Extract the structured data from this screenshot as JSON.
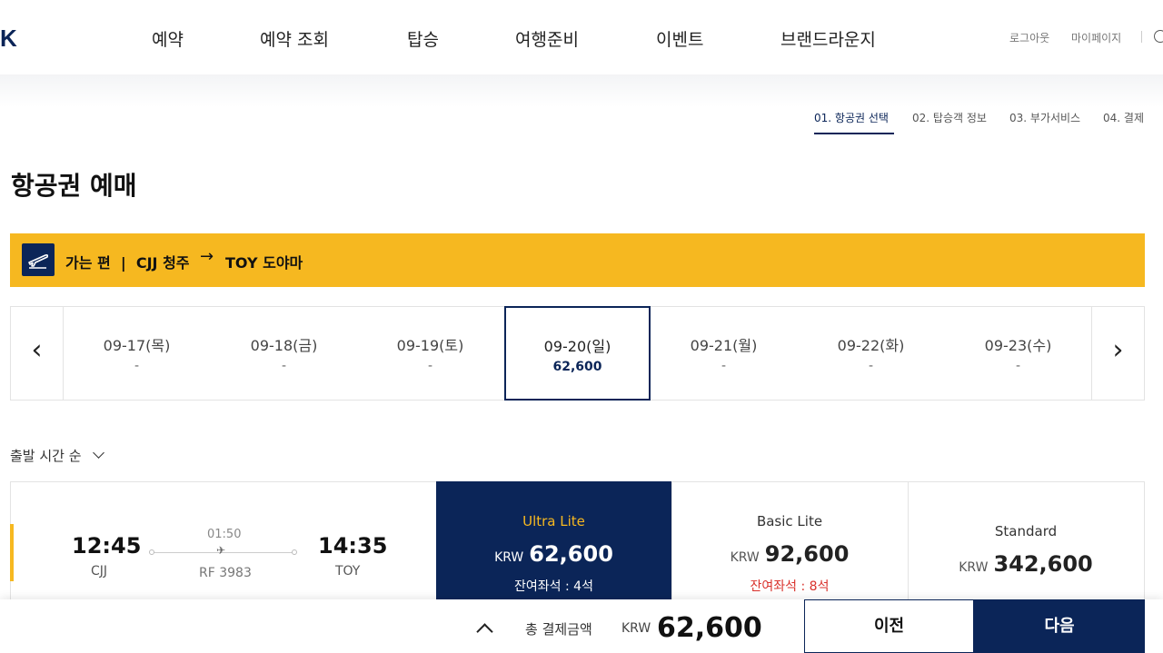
{
  "header": {
    "logo": "K",
    "nav": [
      "예약",
      "예약 조회",
      "탑승",
      "여행준비",
      "이벤트",
      "브랜드라운지"
    ],
    "utility": [
      "로그아웃",
      "마이페이지"
    ]
  },
  "steps": [
    "01. 항공권 선택",
    "02. 탑승객 정보",
    "03. 부가서비스",
    "04. 결제"
  ],
  "page_title": "항공권 예매",
  "route": {
    "label": "가는 편  |  CJJ 청주",
    "arrow": "→",
    "destination": "TOY 도야마"
  },
  "dates": [
    {
      "date": "09-17(목)",
      "price": "-"
    },
    {
      "date": "09-18(금)",
      "price": "-"
    },
    {
      "date": "09-19(토)",
      "price": "-"
    },
    {
      "date": "09-20(일)",
      "price": "62,600"
    },
    {
      "date": "09-21(월)",
      "price": "-"
    },
    {
      "date": "09-22(화)",
      "price": "-"
    },
    {
      "date": "09-23(수)",
      "price": "-"
    }
  ],
  "selected_date_index": 3,
  "sort_label": "출발 시간 순",
  "flight": {
    "dep_time": "12:45",
    "dep_code": "CJJ",
    "duration": "01:50",
    "flight_no": "RF 3983",
    "arr_time": "14:35",
    "arr_code": "TOY",
    "fares": [
      {
        "name": "Ultra Lite",
        "currency": "KRW",
        "amount": "62,600",
        "seats": "잔여좌석 : 4석"
      },
      {
        "name": "Basic Lite",
        "currency": "KRW",
        "amount": "92,600",
        "seats": "잔여좌석 : 8석"
      },
      {
        "name": "Standard",
        "currency": "KRW",
        "amount": "342,600",
        "seats": ""
      }
    ]
  },
  "bottom": {
    "total_label": "총 결제금액",
    "currency": "KRW",
    "amount": "62,600",
    "prev_label": "이전",
    "next_label": "다음"
  },
  "colors": {
    "navy": "#0b2558",
    "accent_yellow": "#f6b820",
    "warning_red": "#d9312b"
  }
}
